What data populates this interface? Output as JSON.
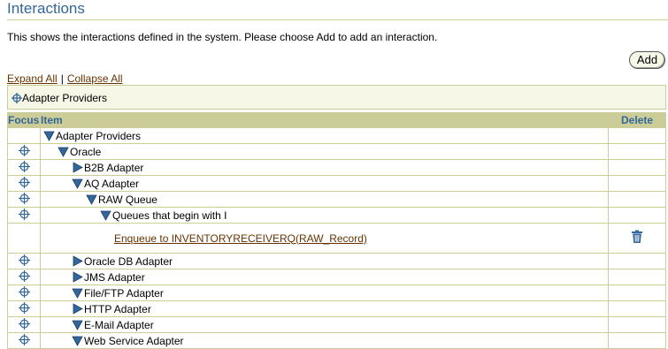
{
  "page": {
    "title": "Interactions",
    "description": "This shows the interactions defined in the system. Please choose Add to add an interaction.",
    "add_label": "Add",
    "expand_all": "Expand All",
    "separator": "|",
    "collapse_all": "Collapse All",
    "focus_path": "Adapter Providers"
  },
  "table": {
    "headers": {
      "focus": "Focus",
      "item": "Item",
      "delete": "Delete"
    },
    "rows": [
      {
        "label": "Adapter Providers",
        "level": 0,
        "state": "expanded",
        "focus": false,
        "delete": false
      },
      {
        "label": "Oracle",
        "level": 1,
        "state": "expanded",
        "focus": true,
        "delete": false
      },
      {
        "label": "B2B Adapter",
        "level": 2,
        "state": "collapsed",
        "focus": true,
        "delete": false
      },
      {
        "label": "AQ Adapter",
        "level": 2,
        "state": "expanded",
        "focus": true,
        "delete": false
      },
      {
        "label": "RAW Queue",
        "level": 3,
        "state": "expanded",
        "focus": true,
        "delete": false
      },
      {
        "label": "Queues that begin with I",
        "level": 4,
        "state": "expanded",
        "focus": true,
        "delete": false
      },
      {
        "label": "Enqueue to INVENTORYRECEIVERQ(RAW_Record)",
        "level": 5,
        "state": "leaf",
        "focus": false,
        "delete": true
      },
      {
        "label": "Oracle DB Adapter",
        "level": 2,
        "state": "collapsed",
        "focus": true,
        "delete": false
      },
      {
        "label": "JMS Adapter",
        "level": 2,
        "state": "collapsed",
        "focus": true,
        "delete": false
      },
      {
        "label": "File/FTP Adapter",
        "level": 2,
        "state": "expanded",
        "focus": true,
        "delete": false
      },
      {
        "label": "HTTP Adapter",
        "level": 2,
        "state": "collapsed",
        "focus": true,
        "delete": false
      },
      {
        "label": "E-Mail Adapter",
        "level": 2,
        "state": "expanded",
        "focus": true,
        "delete": false
      },
      {
        "label": "Web Service Adapter",
        "level": 2,
        "state": "expanded",
        "focus": true,
        "delete": false
      }
    ]
  },
  "colors": {
    "accent": "#336699",
    "header_bg": "#cccc99",
    "link": "#663300",
    "panel_bg": "#f7f7e7"
  },
  "icons": {
    "focus": "crosshair-icon",
    "expanded": "triangle-down-icon",
    "collapsed": "triangle-right-icon",
    "delete": "trash-icon"
  }
}
